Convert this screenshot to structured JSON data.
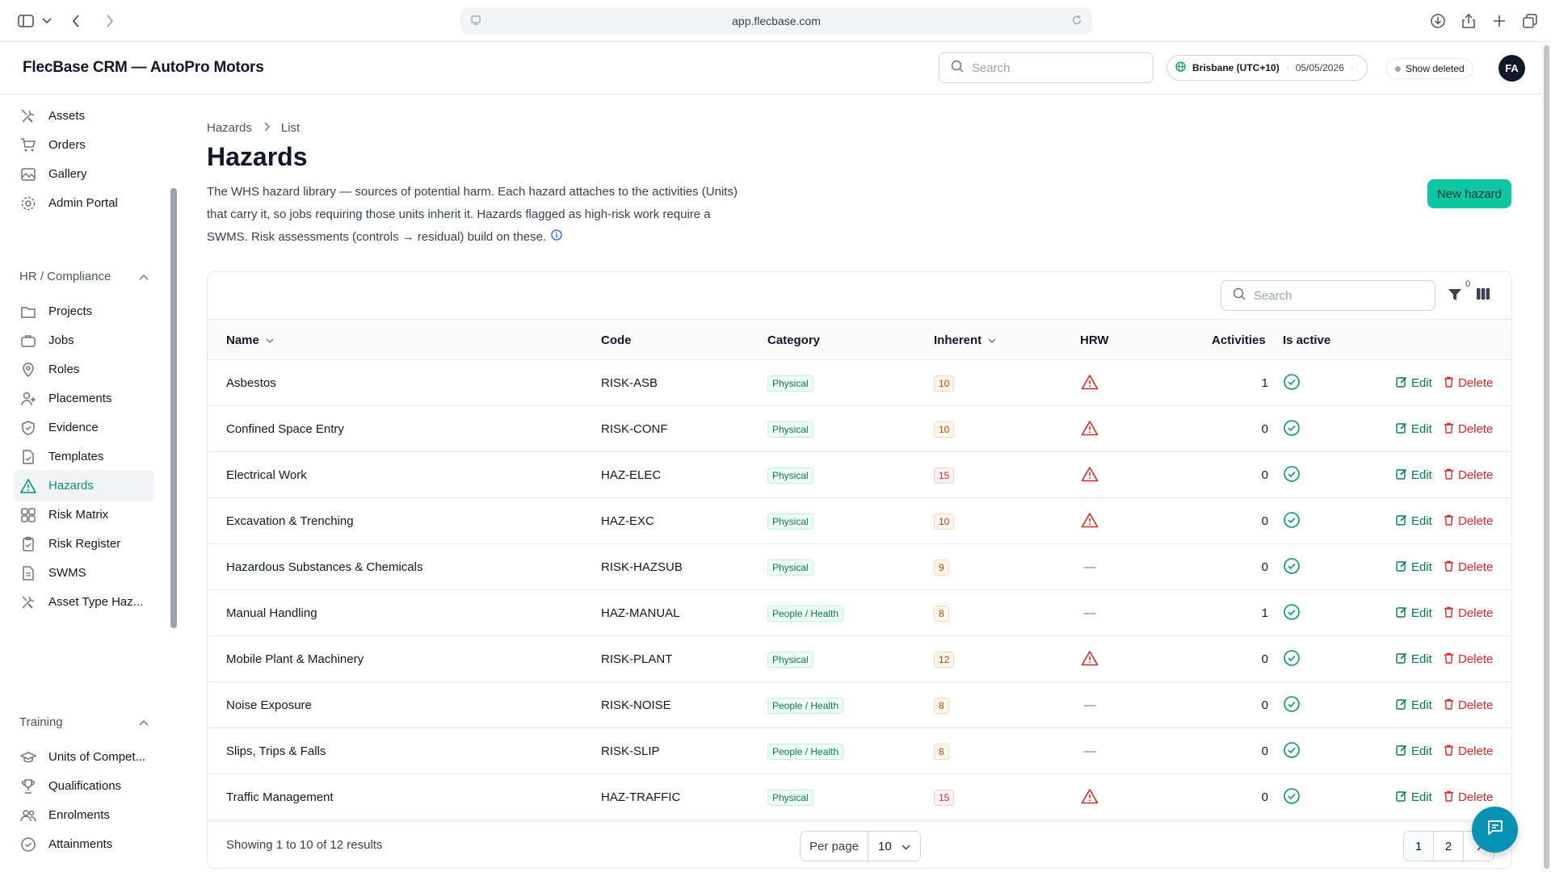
{
  "browser": {
    "url": "app.flecbase.com"
  },
  "header": {
    "title": "FlecBase CRM — AutoPro Motors",
    "search_placeholder": "Search",
    "timezone": "Brisbane (UTC+10)",
    "date": "05/05/2026",
    "show_deleted": "Show deleted",
    "avatar_initials": "FA"
  },
  "sidebar": {
    "items_top": [
      {
        "label": "Assets",
        "icon": "wrench-screwdriver-icon"
      },
      {
        "label": "Orders",
        "icon": "cart-icon"
      },
      {
        "label": "Gallery",
        "icon": "image-icon"
      },
      {
        "label": "Admin Portal",
        "icon": "gear-icon"
      }
    ],
    "group_hr": "HR / Compliance",
    "items_hr": [
      {
        "label": "Projects",
        "icon": "folder-icon"
      },
      {
        "label": "Jobs",
        "icon": "briefcase-icon"
      },
      {
        "label": "Roles",
        "icon": "map-pin-icon"
      },
      {
        "label": "Placements",
        "icon": "user-plus-icon"
      },
      {
        "label": "Evidence",
        "icon": "shield-check-icon"
      },
      {
        "label": "Templates",
        "icon": "document-check-icon"
      },
      {
        "label": "Hazards",
        "icon": "warning-triangle-icon"
      },
      {
        "label": "Risk Matrix",
        "icon": "grid-icon"
      },
      {
        "label": "Risk Register",
        "icon": "clipboard-icon"
      },
      {
        "label": "SWMS",
        "icon": "document-icon"
      },
      {
        "label": "Asset Type Haz...",
        "icon": "wrench-screwdriver-icon"
      }
    ],
    "group_training": "Training",
    "items_training": [
      {
        "label": "Units of Compet...",
        "icon": "academic-cap-icon"
      },
      {
        "label": "Qualifications",
        "icon": "trophy-icon"
      },
      {
        "label": "Enrolments",
        "icon": "users-icon"
      },
      {
        "label": "Attainments",
        "icon": "badge-check-icon"
      }
    ],
    "active": "Hazards"
  },
  "page": {
    "breadcrumb": [
      "Hazards",
      "List"
    ],
    "title": "Hazards",
    "description": "The WHS hazard library — sources of potential harm. Each hazard attaches to the activities (Units) that carry it, so jobs requiring those units inherit it. Hazards flagged as high-risk work require a SWMS. Risk assessments (controls → residual) build on these.",
    "new_button": "New hazard"
  },
  "table": {
    "search_placeholder": "Search",
    "filter_count": "0",
    "columns": [
      "Name",
      "Code",
      "Category",
      "Inherent",
      "HRW",
      "Activities",
      "Is active"
    ],
    "edit_label": "Edit",
    "delete_label": "Delete",
    "hrw_none": "—",
    "rows": [
      {
        "name": "Asbestos",
        "code": "RISK-ASB",
        "category": "Physical",
        "inherent": "10",
        "hrw": true,
        "activities": "1",
        "active": true
      },
      {
        "name": "Confined Space Entry",
        "code": "RISK-CONF",
        "category": "Physical",
        "inherent": "10",
        "hrw": true,
        "activities": "0",
        "active": true
      },
      {
        "name": "Electrical Work",
        "code": "HAZ-ELEC",
        "category": "Physical",
        "inherent": "15",
        "hrw": true,
        "activities": "0",
        "active": true
      },
      {
        "name": "Excavation & Trenching",
        "code": "HAZ-EXC",
        "category": "Physical",
        "inherent": "10",
        "hrw": true,
        "activities": "0",
        "active": true
      },
      {
        "name": "Hazardous Substances & Chemicals",
        "code": "RISK-HAZSUB",
        "category": "Physical",
        "inherent": "9",
        "hrw": false,
        "activities": "0",
        "active": true
      },
      {
        "name": "Manual Handling",
        "code": "HAZ-MANUAL",
        "category": "People / Health",
        "inherent": "8",
        "hrw": false,
        "activities": "1",
        "active": true
      },
      {
        "name": "Mobile Plant & Machinery",
        "code": "RISK-PLANT",
        "category": "Physical",
        "inherent": "12",
        "hrw": true,
        "activities": "0",
        "active": true
      },
      {
        "name": "Noise Exposure",
        "code": "RISK-NOISE",
        "category": "People / Health",
        "inherent": "8",
        "hrw": false,
        "activities": "0",
        "active": true
      },
      {
        "name": "Slips, Trips & Falls",
        "code": "RISK-SLIP",
        "category": "People / Health",
        "inherent": "8",
        "hrw": false,
        "activities": "0",
        "active": true
      },
      {
        "name": "Traffic Management",
        "code": "HAZ-TRAFFIC",
        "category": "Physical",
        "inherent": "15",
        "hrw": true,
        "activities": "0",
        "active": true
      }
    ],
    "showing": "Showing 1 to 10 of 12 results",
    "per_page_label": "Per page",
    "per_page_value": "10",
    "pages": [
      "1",
      "2"
    ]
  },
  "colors": {
    "accent": "#0fc6a3",
    "active_nav": "#059669",
    "danger": "#dc2626"
  }
}
